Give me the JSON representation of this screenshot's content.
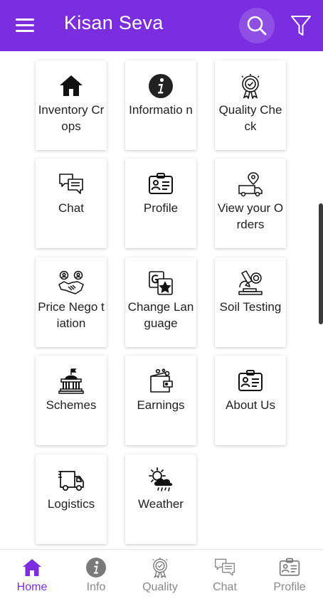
{
  "app_title": "Kisan Seva",
  "colors": {
    "primary": "#7a2ee0",
    "icon": "#111111",
    "inactive": "#888888"
  },
  "tiles": [
    {
      "label": "Inventory Crops",
      "icon": "home-icon"
    },
    {
      "label": "Informatio n",
      "icon": "info-icon"
    },
    {
      "label": "Quality Check",
      "icon": "quality-badge-icon"
    },
    {
      "label": "Chat",
      "icon": "chat-icon"
    },
    {
      "label": "Profile",
      "icon": "id-card-icon"
    },
    {
      "label": "View your Orders",
      "icon": "delivery-truck-icon"
    },
    {
      "label": "Price Nego tiation",
      "icon": "handshake-icon"
    },
    {
      "label": "Change Language",
      "icon": "translate-icon"
    },
    {
      "label": "Soil Testing",
      "icon": "microscope-icon"
    },
    {
      "label": "Schemes",
      "icon": "government-building-icon"
    },
    {
      "label": "Earnings",
      "icon": "wallet-icon"
    },
    {
      "label": "About Us",
      "icon": "id-card-icon"
    },
    {
      "label": "Logistics",
      "icon": "truck-icon"
    },
    {
      "label": "Weather",
      "icon": "weather-icon"
    }
  ],
  "bottom_nav": [
    {
      "label": "Home",
      "icon": "home-icon",
      "active": true
    },
    {
      "label": "Info",
      "icon": "info-icon",
      "active": false
    },
    {
      "label": "Quality",
      "icon": "quality-badge-icon",
      "active": false
    },
    {
      "label": "Chat",
      "icon": "chat-icon",
      "active": false
    },
    {
      "label": "Profile",
      "icon": "id-card-icon",
      "active": false
    }
  ]
}
